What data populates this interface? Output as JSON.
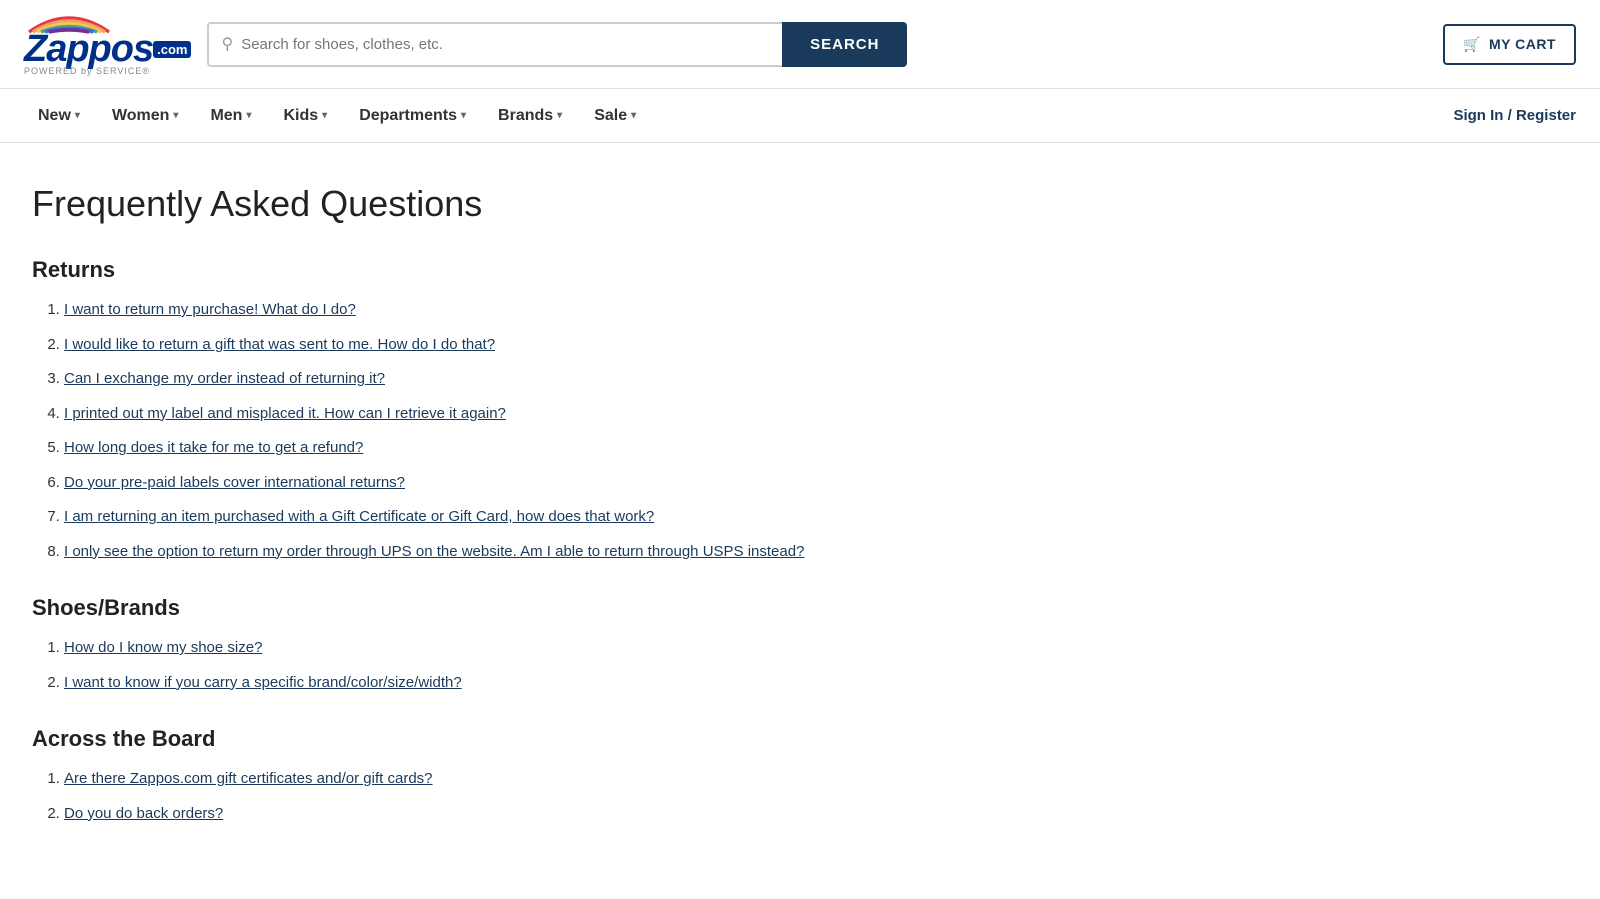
{
  "header": {
    "logo_alt": "Zappos",
    "powered_text": "POWERED by SERVICE®",
    "search_placeholder": "Search for shoes, clothes, etc.",
    "search_button_label": "SEARCH",
    "cart_label": "MY CART"
  },
  "nav": {
    "items": [
      {
        "label": "New",
        "has_dropdown": true
      },
      {
        "label": "Women",
        "has_dropdown": true
      },
      {
        "label": "Men",
        "has_dropdown": true
      },
      {
        "label": "Kids",
        "has_dropdown": true
      },
      {
        "label": "Departments",
        "has_dropdown": true
      },
      {
        "label": "Brands",
        "has_dropdown": true
      },
      {
        "label": "Sale",
        "has_dropdown": true
      }
    ],
    "auth_label": "Sign In / Register"
  },
  "page": {
    "title": "Frequently Asked Questions",
    "sections": [
      {
        "title": "Returns",
        "questions": [
          "I want to return my purchase! What do I do?",
          "I would like to return a gift that was sent to me. How do I do that?",
          "Can I exchange my order instead of returning it?",
          "I printed out my label and misplaced it. How can I retrieve it again?",
          "How long does it take for me to get a refund?",
          "Do your pre-paid labels cover international returns?",
          "I am returning an item purchased with a Gift Certificate or Gift Card, how does that work?",
          "I only see the option to return my order through UPS on the website. Am I able to return through USPS instead?"
        ]
      },
      {
        "title": "Shoes/Brands",
        "questions": [
          "How do I know my shoe size?",
          "I want to know if you carry a specific brand/color/size/width?"
        ]
      },
      {
        "title": "Across the Board",
        "questions": [
          "Are there Zappos.com gift certificates and/or gift cards?",
          "Do you do back orders?"
        ]
      }
    ]
  }
}
